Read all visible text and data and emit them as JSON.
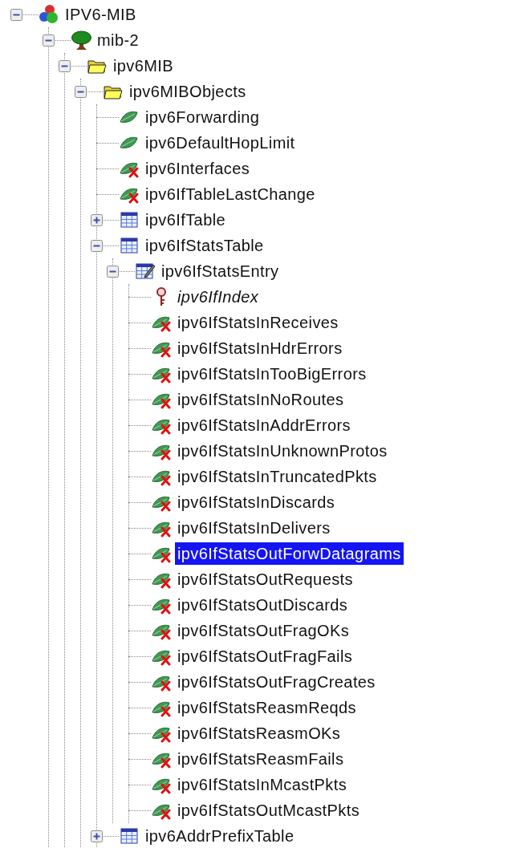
{
  "tree": [
    {
      "label": "IPV6-MIB",
      "kind": "module",
      "expanded": true,
      "selected": false,
      "children": [
        {
          "label": "mib-2",
          "kind": "tree",
          "expanded": true,
          "selected": false,
          "children": [
            {
              "label": "ipv6MIB",
              "kind": "folder",
              "expanded": true,
              "selected": false,
              "children": [
                {
                  "label": "ipv6MIBObjects",
                  "kind": "folder",
                  "expanded": true,
                  "selected": false,
                  "children": [
                    {
                      "label": "ipv6Forwarding",
                      "kind": "scalar",
                      "selected": false
                    },
                    {
                      "label": "ipv6DefaultHopLimit",
                      "kind": "scalar",
                      "selected": false
                    },
                    {
                      "label": "ipv6Interfaces",
                      "kind": "readonly",
                      "selected": false
                    },
                    {
                      "label": "ipv6IfTableLastChange",
                      "kind": "readonly",
                      "selected": false
                    },
                    {
                      "label": "ipv6IfTable",
                      "kind": "table",
                      "expanded": false,
                      "selected": false
                    },
                    {
                      "label": "ipv6IfStatsTable",
                      "kind": "table",
                      "expanded": true,
                      "selected": false,
                      "children": [
                        {
                          "label": "ipv6IfStatsEntry",
                          "kind": "entry",
                          "expanded": true,
                          "selected": false,
                          "children": [
                            {
                              "label": "ipv6IfIndex",
                              "kind": "index",
                              "selected": false
                            },
                            {
                              "label": "ipv6IfStatsInReceives",
                              "kind": "readonly",
                              "selected": false
                            },
                            {
                              "label": "ipv6IfStatsInHdrErrors",
                              "kind": "readonly",
                              "selected": false
                            },
                            {
                              "label": "ipv6IfStatsInTooBigErrors",
                              "kind": "readonly",
                              "selected": false
                            },
                            {
                              "label": "ipv6IfStatsInNoRoutes",
                              "kind": "readonly",
                              "selected": false
                            },
                            {
                              "label": "ipv6IfStatsInAddrErrors",
                              "kind": "readonly",
                              "selected": false
                            },
                            {
                              "label": "ipv6IfStatsInUnknownProtos",
                              "kind": "readonly",
                              "selected": false
                            },
                            {
                              "label": "ipv6IfStatsInTruncatedPkts",
                              "kind": "readonly",
                              "selected": false
                            },
                            {
                              "label": "ipv6IfStatsInDiscards",
                              "kind": "readonly",
                              "selected": false
                            },
                            {
                              "label": "ipv6IfStatsInDelivers",
                              "kind": "readonly",
                              "selected": false
                            },
                            {
                              "label": "ipv6IfStatsOutForwDatagrams",
                              "kind": "readonly",
                              "selected": true
                            },
                            {
                              "label": "ipv6IfStatsOutRequests",
                              "kind": "readonly",
                              "selected": false
                            },
                            {
                              "label": "ipv6IfStatsOutDiscards",
                              "kind": "readonly",
                              "selected": false
                            },
                            {
                              "label": "ipv6IfStatsOutFragOKs",
                              "kind": "readonly",
                              "selected": false
                            },
                            {
                              "label": "ipv6IfStatsOutFragFails",
                              "kind": "readonly",
                              "selected": false
                            },
                            {
                              "label": "ipv6IfStatsOutFragCreates",
                              "kind": "readonly",
                              "selected": false
                            },
                            {
                              "label": "ipv6IfStatsReasmReqds",
                              "kind": "readonly",
                              "selected": false
                            },
                            {
                              "label": "ipv6IfStatsReasmOKs",
                              "kind": "readonly",
                              "selected": false
                            },
                            {
                              "label": "ipv6IfStatsReasmFails",
                              "kind": "readonly",
                              "selected": false
                            },
                            {
                              "label": "ipv6IfStatsInMcastPkts",
                              "kind": "readonly",
                              "selected": false
                            },
                            {
                              "label": "ipv6IfStatsOutMcastPkts",
                              "kind": "readonly",
                              "selected": false
                            }
                          ]
                        }
                      ]
                    },
                    {
                      "label": "ipv6AddrPrefixTable",
                      "kind": "table",
                      "expanded": false,
                      "selected": false
                    }
                  ]
                }
              ]
            }
          ]
        }
      ]
    }
  ]
}
